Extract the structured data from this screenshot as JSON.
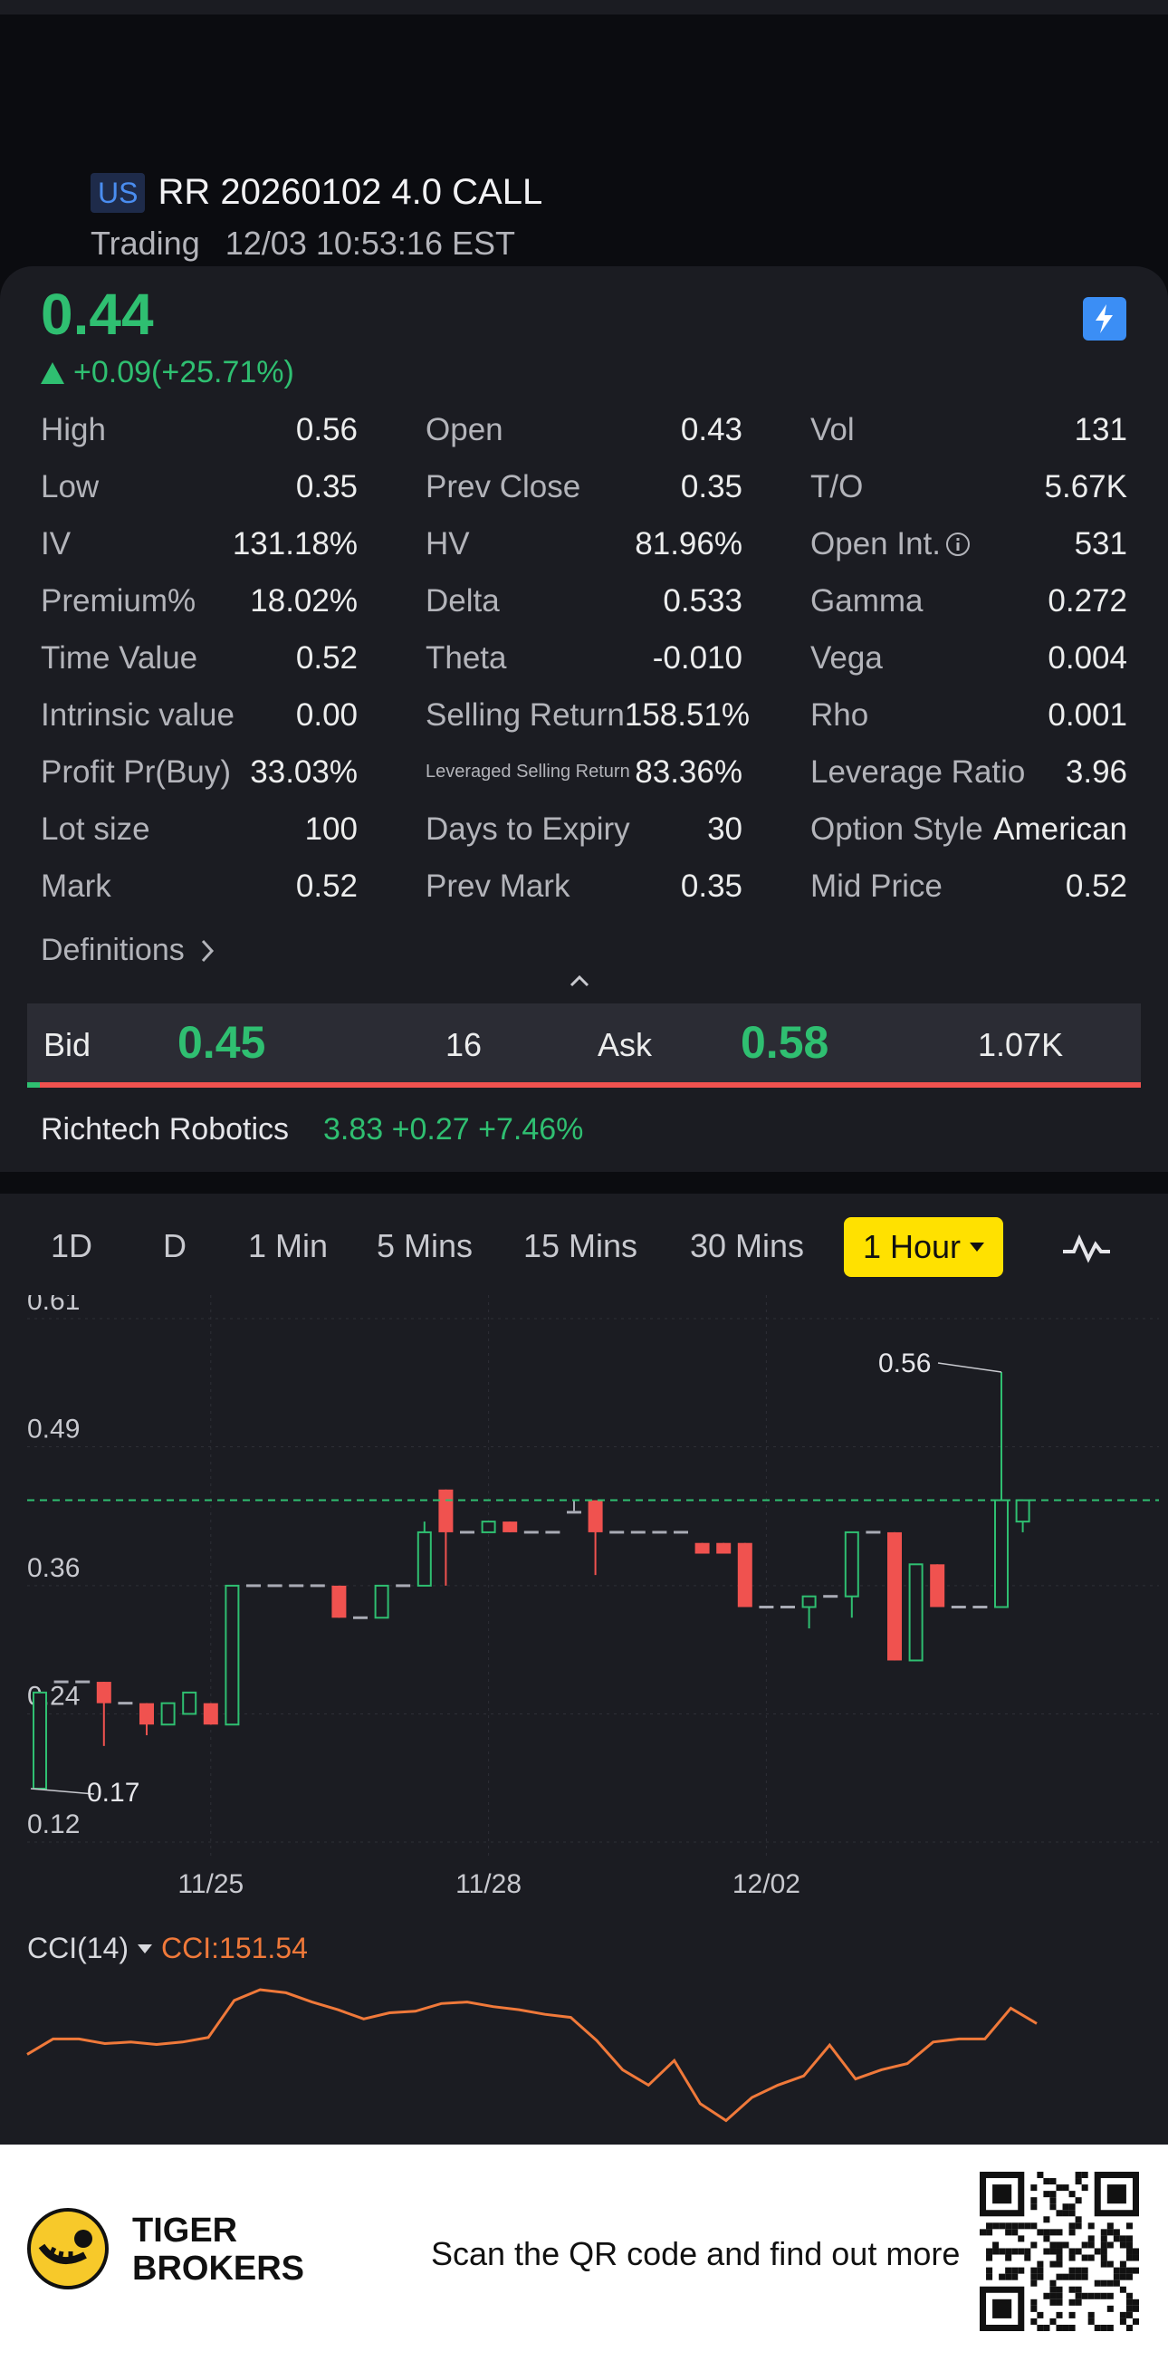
{
  "header": {
    "market": "US",
    "symbol": "RR 20260102 4.0 CALL",
    "status": "Trading",
    "time": "12/03 10:53:16 EST"
  },
  "quote": {
    "price": "0.44",
    "change": "+0.09(+25.71%)",
    "badge": "1"
  },
  "stats": {
    "col1": [
      {
        "label": "High",
        "value": "0.56"
      },
      {
        "label": "Low",
        "value": "0.35"
      },
      {
        "label": "IV",
        "value": "131.18%"
      },
      {
        "label": "Premium%",
        "value": "18.02%"
      },
      {
        "label": "Time Value",
        "value": "0.52"
      },
      {
        "label": "Intrinsic value",
        "value": "0.00"
      },
      {
        "label": "Profit Pr(Buy)",
        "value": "33.03%"
      },
      {
        "label": "Lot size",
        "value": "100"
      },
      {
        "label": "Mark",
        "value": "0.52"
      }
    ],
    "col2": [
      {
        "label": "Open",
        "value": "0.43"
      },
      {
        "label": "Prev Close",
        "value": "0.35"
      },
      {
        "label": "HV",
        "value": "81.96%"
      },
      {
        "label": "Delta",
        "value": "0.533"
      },
      {
        "label": "Theta",
        "value": "-0.010"
      },
      {
        "label": "Selling Return",
        "value": "158.51%"
      },
      {
        "label": "Leveraged Selling Return",
        "value": "83.36%"
      },
      {
        "label": "Days to Expiry",
        "value": "30"
      },
      {
        "label": "Prev Mark",
        "value": "0.35"
      }
    ],
    "col3": [
      {
        "label": "Vol",
        "value": "131"
      },
      {
        "label": "T/O",
        "value": "5.67K"
      },
      {
        "label": "Open Int.",
        "value": "531"
      },
      {
        "label": "Gamma",
        "value": "0.272"
      },
      {
        "label": "Vega",
        "value": "0.004"
      },
      {
        "label": "Rho",
        "value": "0.001"
      },
      {
        "label": "Leverage Ratio",
        "value": "3.96"
      },
      {
        "label": "Option Style",
        "value": "American"
      },
      {
        "label": "Mid Price",
        "value": "0.52"
      }
    ]
  },
  "definitions_label": "Definitions",
  "bid_ask": {
    "bid_label": "Bid",
    "bid_price": "0.45",
    "bid_size": "16",
    "ask_label": "Ask",
    "ask_price": "0.58",
    "ask_size": "1.07K"
  },
  "underlying": {
    "name": "Richtech Robotics",
    "quote": "3.83 +0.27 +7.46%"
  },
  "timeframes": [
    "1D",
    "D",
    "1 Min",
    "5 Mins",
    "15 Mins",
    "30 Mins"
  ],
  "active_timeframe": "1 Hour",
  "cci": {
    "label": "CCI(14)",
    "value": "CCI:151.54"
  },
  "footer": {
    "brand_line1": "TIGER",
    "brand_line2": "BROKERS",
    "scan_text": "Scan the QR code and find out more"
  },
  "colors": {
    "up": "#2fbf71",
    "down": "#f0524f",
    "flat": "#a9abb5",
    "cci_line": "#f0793a",
    "accent_yellow": "#ffe100"
  },
  "chart_data": {
    "type": "candlestick",
    "y_ticks": [
      "0.61",
      "0.49",
      "0.36",
      "0.24",
      "0.12"
    ],
    "y_tick_values": [
      0.61,
      0.49,
      0.36,
      0.24,
      0.12
    ],
    "ylim": [
      0.12,
      0.61
    ],
    "x_ticks": [
      {
        "label": "11/25",
        "index": 8
      },
      {
        "label": "11/28",
        "index": 21
      },
      {
        "label": "12/02",
        "index": 34
      }
    ],
    "last_price_line": 0.44,
    "high_label": "0.56",
    "low_label": "0.17",
    "candles": [
      {
        "o": 0.17,
        "h": 0.26,
        "l": 0.17,
        "c": 0.26
      },
      {
        "o": 0.27,
        "h": 0.27,
        "l": 0.27,
        "c": 0.27
      },
      {
        "o": 0.27,
        "h": 0.27,
        "l": 0.27,
        "c": 0.27
      },
      {
        "o": 0.27,
        "h": 0.27,
        "l": 0.21,
        "c": 0.25
      },
      {
        "o": 0.25,
        "h": 0.25,
        "l": 0.25,
        "c": 0.25
      },
      {
        "o": 0.25,
        "h": 0.25,
        "l": 0.22,
        "c": 0.23
      },
      {
        "o": 0.23,
        "h": 0.25,
        "l": 0.23,
        "c": 0.25
      },
      {
        "o": 0.24,
        "h": 0.26,
        "l": 0.24,
        "c": 0.26
      },
      {
        "o": 0.25,
        "h": 0.25,
        "l": 0.23,
        "c": 0.23
      },
      {
        "o": 0.23,
        "h": 0.36,
        "l": 0.23,
        "c": 0.36
      },
      {
        "o": 0.36,
        "h": 0.36,
        "l": 0.36,
        "c": 0.36
      },
      {
        "o": 0.36,
        "h": 0.36,
        "l": 0.36,
        "c": 0.36
      },
      {
        "o": 0.36,
        "h": 0.36,
        "l": 0.36,
        "c": 0.36
      },
      {
        "o": 0.36,
        "h": 0.36,
        "l": 0.36,
        "c": 0.36
      },
      {
        "o": 0.36,
        "h": 0.36,
        "l": 0.33,
        "c": 0.33
      },
      {
        "o": 0.33,
        "h": 0.33,
        "l": 0.33,
        "c": 0.33
      },
      {
        "o": 0.33,
        "h": 0.36,
        "l": 0.33,
        "c": 0.36
      },
      {
        "o": 0.36,
        "h": 0.36,
        "l": 0.36,
        "c": 0.36
      },
      {
        "o": 0.36,
        "h": 0.42,
        "l": 0.36,
        "c": 0.41
      },
      {
        "o": 0.45,
        "h": 0.45,
        "l": 0.36,
        "c": 0.41
      },
      {
        "o": 0.41,
        "h": 0.41,
        "l": 0.41,
        "c": 0.41
      },
      {
        "o": 0.41,
        "h": 0.42,
        "l": 0.41,
        "c": 0.42
      },
      {
        "o": 0.42,
        "h": 0.42,
        "l": 0.41,
        "c": 0.41
      },
      {
        "o": 0.41,
        "h": 0.41,
        "l": 0.41,
        "c": 0.41
      },
      {
        "o": 0.41,
        "h": 0.41,
        "l": 0.41,
        "c": 0.41
      },
      {
        "o": 0.43,
        "h": 0.44,
        "l": 0.43,
        "c": 0.43
      },
      {
        "o": 0.44,
        "h": 0.44,
        "l": 0.37,
        "c": 0.41
      },
      {
        "o": 0.41,
        "h": 0.41,
        "l": 0.41,
        "c": 0.41
      },
      {
        "o": 0.41,
        "h": 0.41,
        "l": 0.41,
        "c": 0.41
      },
      {
        "o": 0.41,
        "h": 0.41,
        "l": 0.41,
        "c": 0.41
      },
      {
        "o": 0.41,
        "h": 0.41,
        "l": 0.41,
        "c": 0.41
      },
      {
        "o": 0.4,
        "h": 0.4,
        "l": 0.39,
        "c": 0.39
      },
      {
        "o": 0.4,
        "h": 0.4,
        "l": 0.39,
        "c": 0.39
      },
      {
        "o": 0.4,
        "h": 0.4,
        "l": 0.34,
        "c": 0.34
      },
      {
        "o": 0.34,
        "h": 0.34,
        "l": 0.34,
        "c": 0.34
      },
      {
        "o": 0.34,
        "h": 0.34,
        "l": 0.34,
        "c": 0.34
      },
      {
        "o": 0.34,
        "h": 0.35,
        "l": 0.32,
        "c": 0.35
      },
      {
        "o": 0.35,
        "h": 0.35,
        "l": 0.35,
        "c": 0.35
      },
      {
        "o": 0.35,
        "h": 0.41,
        "l": 0.33,
        "c": 0.41
      },
      {
        "o": 0.41,
        "h": 0.41,
        "l": 0.41,
        "c": 0.41
      },
      {
        "o": 0.41,
        "h": 0.41,
        "l": 0.29,
        "c": 0.29
      },
      {
        "o": 0.29,
        "h": 0.38,
        "l": 0.29,
        "c": 0.38
      },
      {
        "o": 0.38,
        "h": 0.38,
        "l": 0.34,
        "c": 0.34
      },
      {
        "o": 0.34,
        "h": 0.34,
        "l": 0.34,
        "c": 0.34
      },
      {
        "o": 0.34,
        "h": 0.34,
        "l": 0.34,
        "c": 0.34
      },
      {
        "o": 0.34,
        "h": 0.56,
        "l": 0.34,
        "c": 0.44
      },
      {
        "o": 0.42,
        "h": 0.44,
        "l": 0.41,
        "c": 0.44
      }
    ],
    "cci_values": [
      -60,
      -10,
      -10,
      -25,
      -20,
      -28,
      -20,
      -5,
      115,
      150,
      140,
      110,
      85,
      55,
      75,
      80,
      105,
      110,
      95,
      85,
      70,
      60,
      -15,
      -110,
      -160,
      -80,
      -220,
      -275,
      -200,
      -160,
      -130,
      -30,
      -140,
      -110,
      -90,
      -20,
      -10,
      -10,
      90,
      40
    ],
    "cci_ylim": [
      -300,
      200
    ]
  }
}
